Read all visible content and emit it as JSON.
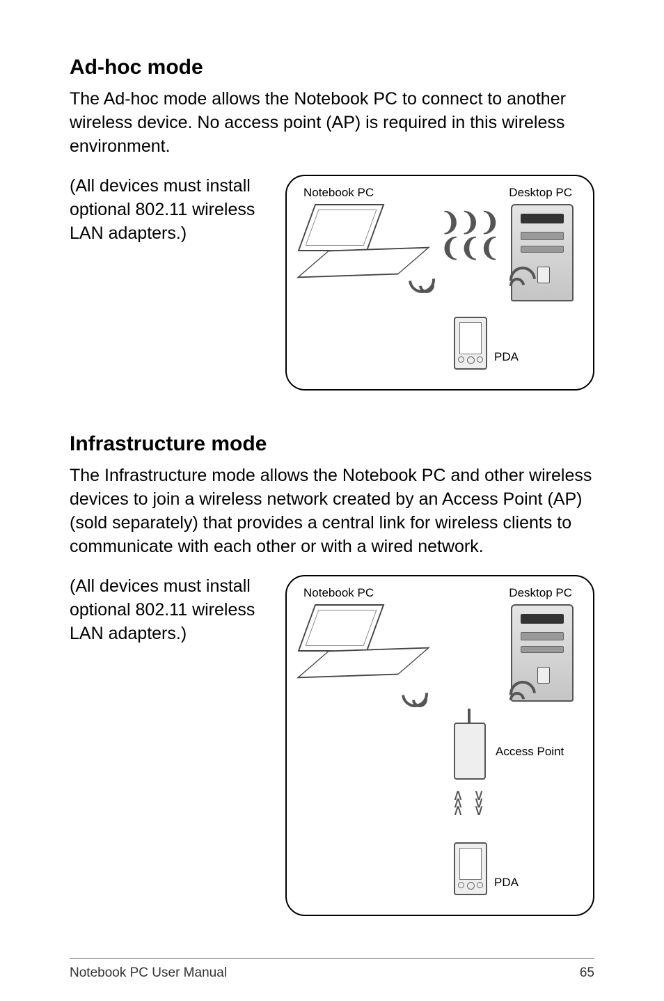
{
  "adhoc": {
    "heading": "Ad-hoc mode",
    "intro": "The Ad-hoc mode allows the Notebook PC to connect to another wireless device. No access point (AP) is required in this wireless environment.",
    "side_note": "(All devices must install optional 802.11 wireless LAN adapters.)",
    "label_notebook": "Notebook PC",
    "label_desktop": "Desktop PC",
    "label_pda": "PDA"
  },
  "infra": {
    "heading": "Infrastructure mode",
    "intro": "The Infrastructure mode allows the Notebook PC and other wireless devices to join a wireless network created by an Access Point (AP) (sold separately) that provides a central link for wireless clients to communicate with each other or with a wired network.",
    "side_note": "(All devices must install optional 802.11 wireless LAN adapters.)",
    "label_notebook": "Notebook PC",
    "label_desktop": "Desktop PC",
    "label_access_point": "Access Point",
    "label_pda": "PDA"
  },
  "footer": {
    "left": "Notebook PC User Manual",
    "page": "65"
  }
}
